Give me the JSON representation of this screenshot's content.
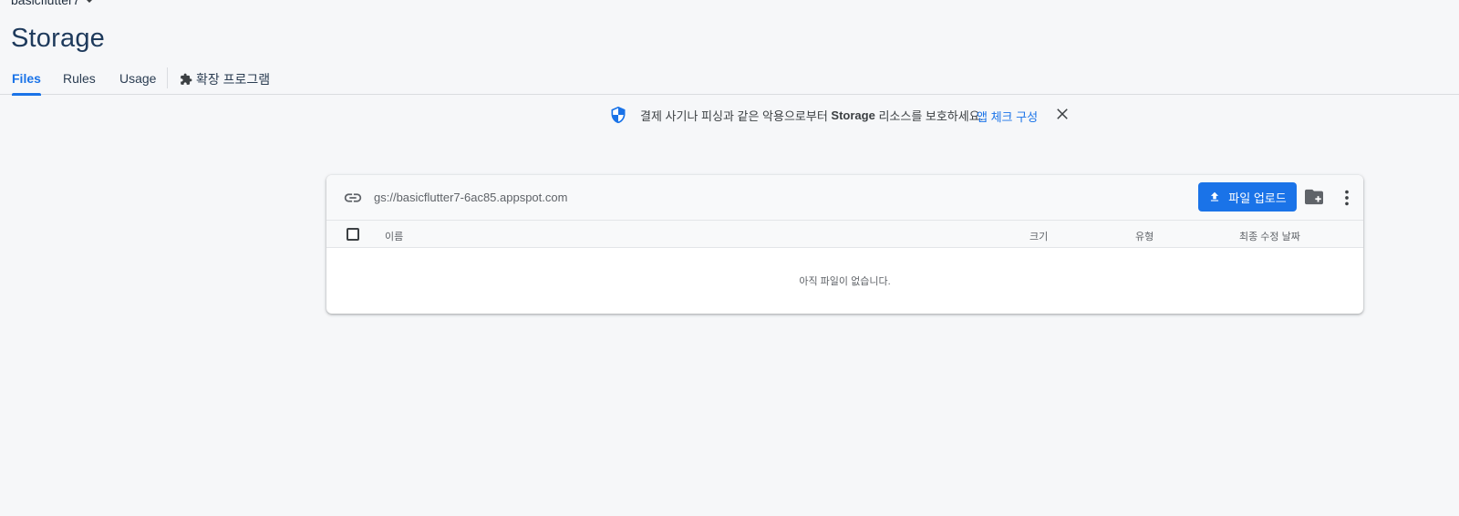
{
  "project": {
    "name": "basicflutter7"
  },
  "page": {
    "title": "Storage"
  },
  "tabs": [
    {
      "label": "Files",
      "active": true
    },
    {
      "label": "Rules",
      "active": false
    },
    {
      "label": "Usage",
      "active": false
    },
    {
      "label": "확장 프로그램",
      "active": false,
      "icon": "extensions-icon"
    }
  ],
  "banner": {
    "icon": "shield-icon",
    "text_before": "결제 사기나 피싱과 같은 악용으로부터 ",
    "text_bold": "Storage",
    "text_after": " 리소스를 보호하세요.",
    "link_label": "앱 체크 구성",
    "close_icon": "close-icon"
  },
  "storage": {
    "bucket_path": "gs://basicflutter7-6ac85.appspot.com",
    "upload_label": "파일 업로드",
    "columns": {
      "name": "이름",
      "size": "크기",
      "type": "유형",
      "modified": "최종 수정 날짜"
    },
    "empty_message": "아직 파일이 없습니다."
  },
  "colors": {
    "accent": "#1a73e8",
    "title": "#1e3a5c",
    "background": "#f6f7f9"
  }
}
